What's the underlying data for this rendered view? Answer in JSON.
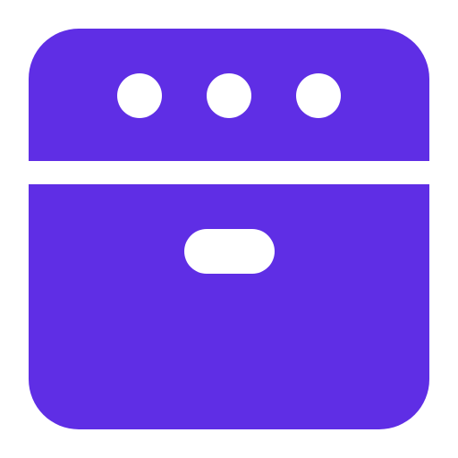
{
  "icon": {
    "name": "oven-icon",
    "colors": {
      "body": "#5F2EE5",
      "cutout": "#FFFFFF",
      "background": "#FFFFFF"
    },
    "parts": {
      "knobs": [
        "knob-left-icon",
        "knob-middle-icon",
        "knob-right-icon"
      ],
      "handle": "oven-handle-icon",
      "divider": "oven-divider"
    }
  }
}
